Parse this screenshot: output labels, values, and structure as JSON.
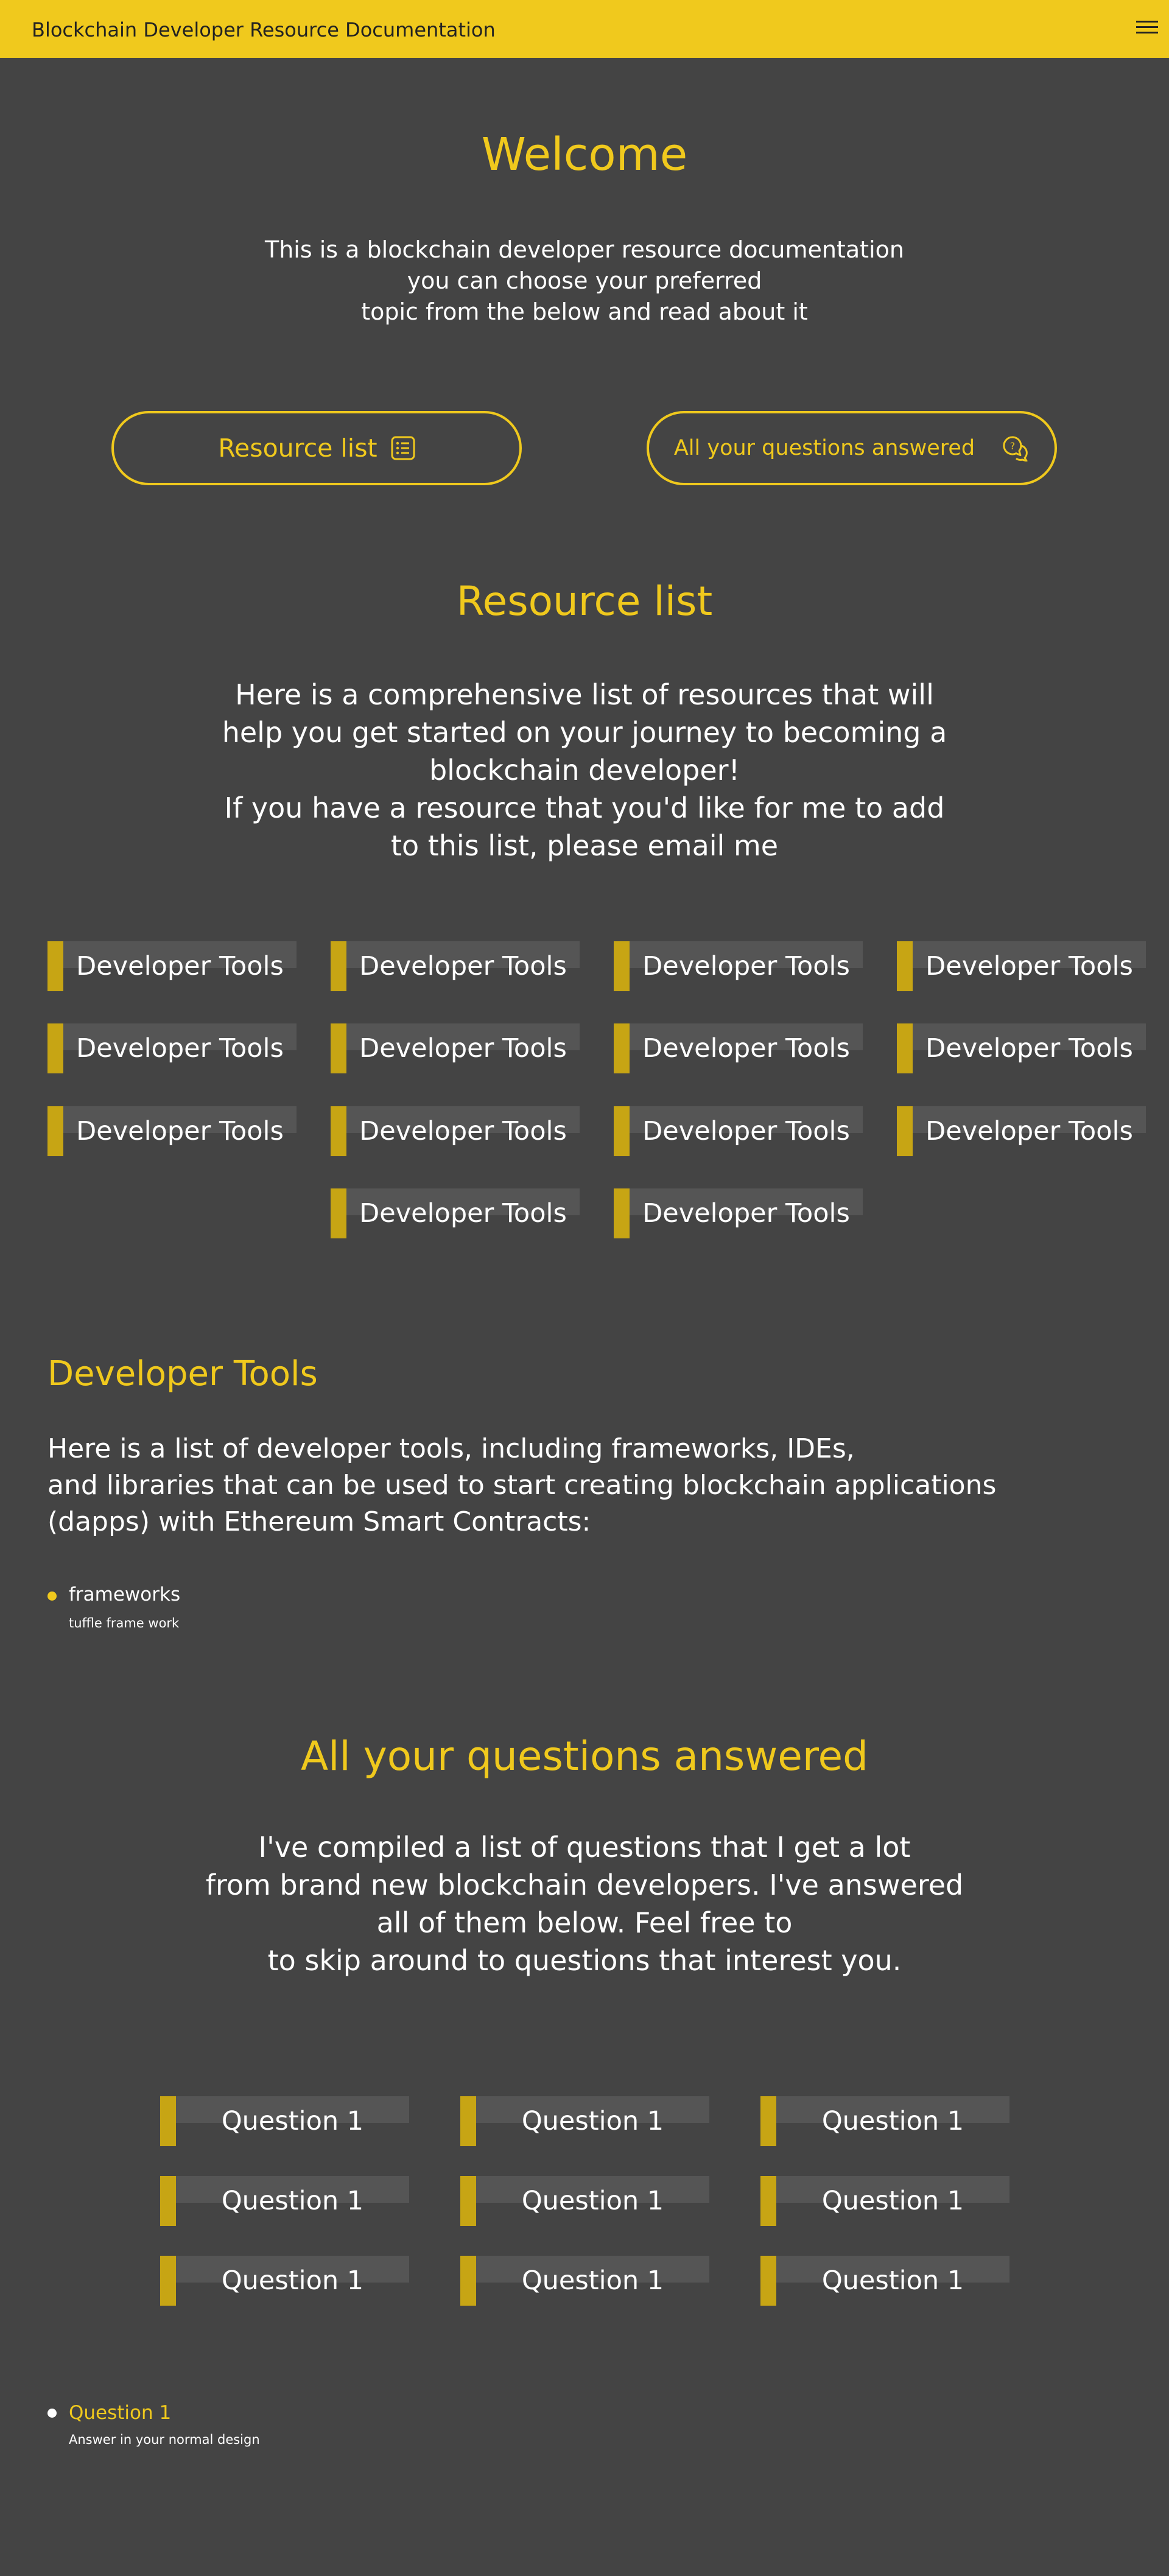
{
  "header": {
    "title": "Blockchain Developer Resource Documentation"
  },
  "welcome": {
    "title": "Welcome",
    "lines": [
      "This is a blockchain developer resource documentation",
      "you can choose your preferred",
      "topic from the below and read about it"
    ]
  },
  "buttons": {
    "resource_list": "Resource list",
    "questions": "All your questions answered"
  },
  "resources": {
    "title": "Resource list",
    "lines": [
      "Here is a comprehensive list of resources that will",
      "help you get started on your journey to becoming a",
      "blockchain developer!",
      "If you have a resource that you'd like for me to add",
      "to this list, please email me"
    ],
    "tiles": [
      "Developer Tools",
      "Developer Tools",
      "Developer Tools",
      "Developer Tools",
      "Developer Tools",
      "Developer Tools",
      "Developer Tools",
      "Developer Tools",
      "Developer Tools",
      "Developer Tools",
      "Developer Tools",
      "Developer Tools",
      "Developer Tools",
      "Developer Tools"
    ]
  },
  "devtools": {
    "title": "Developer Tools",
    "lines": [
      "Here is a list of developer tools, including frameworks, IDEs,",
      "and libraries that can be used to start creating blockchain applications",
      "(dapps) with Ethereum Smart Contracts:"
    ],
    "item_title": "frameworks",
    "item_sub": "tuffle frame work"
  },
  "questions": {
    "title": "All your questions answered",
    "lines": [
      "I've compiled a list of questions that I get a lot",
      "from brand new blockchain developers. I've answered",
      "all of them below. Feel free to",
      "to skip around to questions that interest you."
    ],
    "tiles": [
      "Question 1",
      "Question 1",
      "Question 1",
      "Question 1",
      "Question 1",
      "Question 1",
      "Question 1",
      "Question 1",
      "Question 1"
    ],
    "item_title": "Question 1",
    "item_sub": "Answer in your normal design"
  },
  "colors": {
    "accent": "#f0c91d",
    "background": "#444444",
    "tile_bar": "#c7a514"
  }
}
